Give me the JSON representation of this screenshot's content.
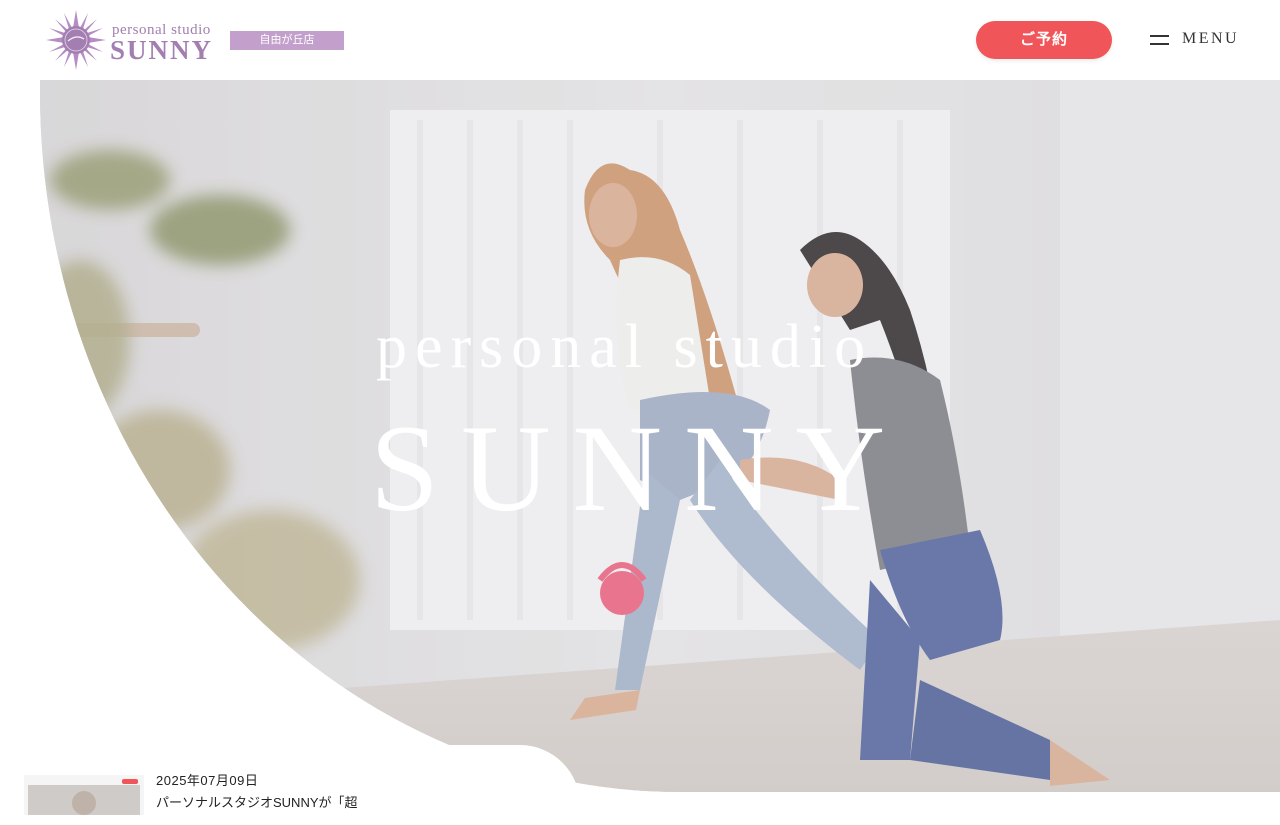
{
  "header": {
    "logo_sub": "personal studio",
    "logo_main": "SUNNY",
    "branch": "自由が丘店",
    "reserve_label": "ご予約",
    "menu_label": "MENU"
  },
  "hero": {
    "subtitle": "personal studio",
    "title": "SUNNY"
  },
  "news": {
    "date": "2025年07月09日",
    "title": "パーソナルスタジオSUNNYが「超"
  },
  "colors": {
    "brand_purple": "#a27fb0",
    "badge_purple": "#c3a0cb",
    "reserve_red": "#f0555a"
  },
  "icons": [
    "sun-logo-icon",
    "hamburger-icon"
  ]
}
